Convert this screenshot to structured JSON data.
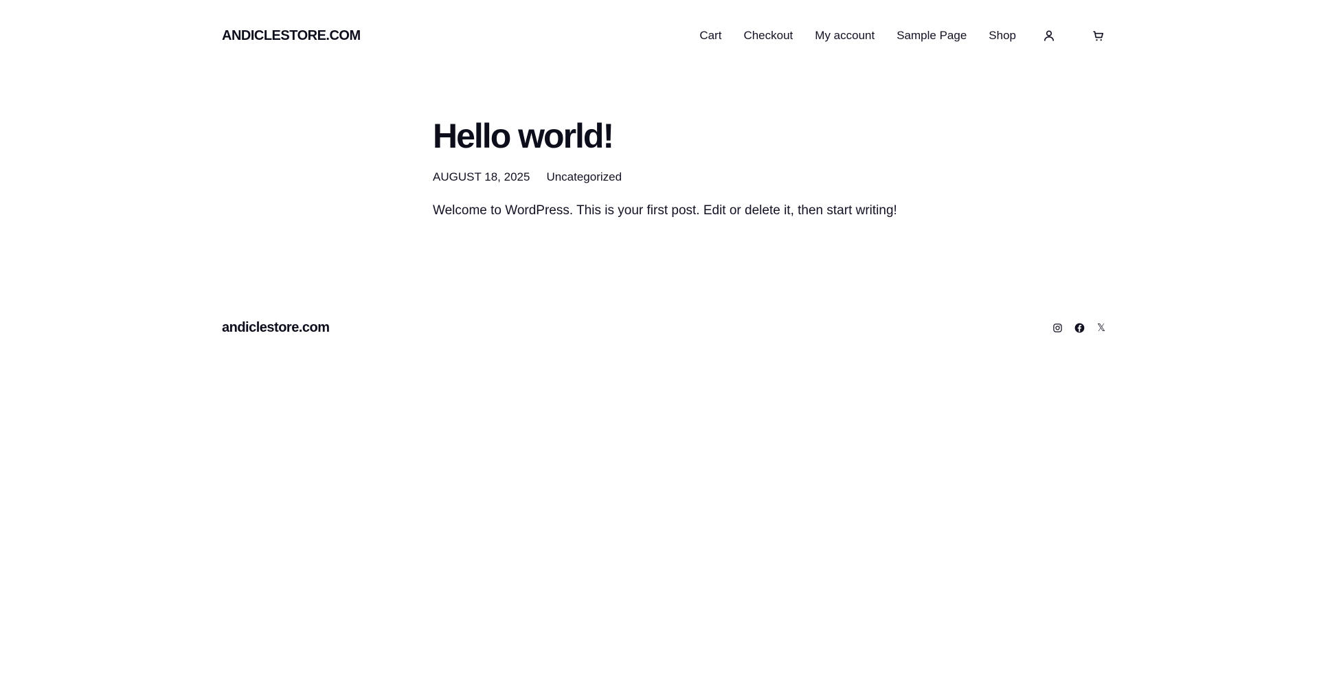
{
  "header": {
    "site_title": "ANDICLESTORE.COM",
    "nav": [
      {
        "label": "Cart"
      },
      {
        "label": "Checkout"
      },
      {
        "label": "My account"
      },
      {
        "label": "Sample Page"
      },
      {
        "label": "Shop"
      }
    ],
    "icons": {
      "account": "user-icon",
      "cart": "shopping-cart-icon"
    }
  },
  "post": {
    "title": "Hello world!",
    "date": "AUGUST 18, 2025",
    "category": "Uncategorized",
    "content": "Welcome to WordPress. This is your first post. Edit or delete it, then start writing!"
  },
  "footer": {
    "site_title": "andiclestore.com",
    "social": [
      {
        "icon": "instagram-icon"
      },
      {
        "icon": "facebook-icon"
      },
      {
        "icon": "x-twitter-icon",
        "glyph": "𝕏"
      }
    ]
  },
  "colors": {
    "background": "#ffffff",
    "text": "#111122",
    "heading": "#0d0e1c"
  }
}
